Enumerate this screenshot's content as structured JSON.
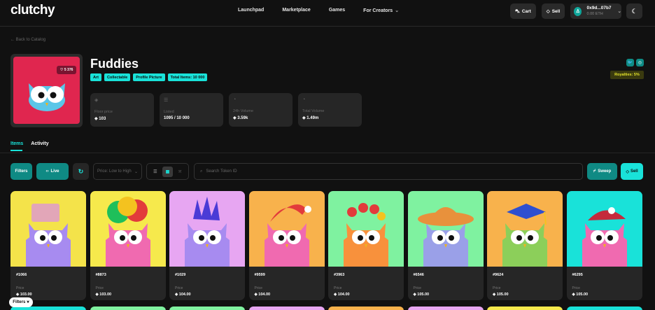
{
  "app": {
    "logo": "clutchy"
  },
  "nav": {
    "items": [
      "Launchpad",
      "Marketplace",
      "Games",
      "For Creators"
    ]
  },
  "header_actions": {
    "cart": "Cart",
    "sell": "Sell",
    "wallet_address": "0x9d...07b7",
    "wallet_balance": "0.00 ETH"
  },
  "collection": {
    "back": "← Back to Catalog",
    "title": "Fuddies",
    "likes": "5 376",
    "tags": [
      "Art",
      "Collectable",
      "Profile Picture",
      "Total Items: 10 000"
    ],
    "royalties": "Royalties: 5%",
    "stats": [
      {
        "label": "Floor price",
        "value": "103",
        "icon": "diamond-icon"
      },
      {
        "label": "Listed",
        "value": "1095 / 10 000",
        "icon": "list-icon"
      },
      {
        "label": "24h Volume",
        "value": "3.59k",
        "icon": "volume-icon"
      },
      {
        "label": "Total Volume",
        "value": "1.49m",
        "icon": "volume-icon"
      }
    ]
  },
  "tabs": [
    "Items",
    "Activity"
  ],
  "toolbar": {
    "filters": "Filters",
    "live": "Live",
    "sort": "Price: Low to High",
    "search_placeholder": "Search Token ID",
    "sweep": "Sweep",
    "sell": "Sell"
  },
  "price_label": "Price",
  "items": [
    {
      "id": "#1066",
      "price": "103.00",
      "bg": "#f4e34a"
    },
    {
      "id": "#8873",
      "price": "103.00",
      "bg": "#f6e94c"
    },
    {
      "id": "#1029",
      "price": "104.00",
      "bg": "#e7a6f2"
    },
    {
      "id": "#9599",
      "price": "104.00",
      "bg": "#f8b24c"
    },
    {
      "id": "#3963",
      "price": "104.00",
      "bg": "#7ff2a0"
    },
    {
      "id": "#6546",
      "price": "105.00",
      "bg": "#7ff2a0"
    },
    {
      "id": "#9624",
      "price": "105.00",
      "bg": "#f8b24c"
    },
    {
      "id": "#6295",
      "price": "105.00",
      "bg": "#19e2d9"
    }
  ],
  "fab": "Filters"
}
